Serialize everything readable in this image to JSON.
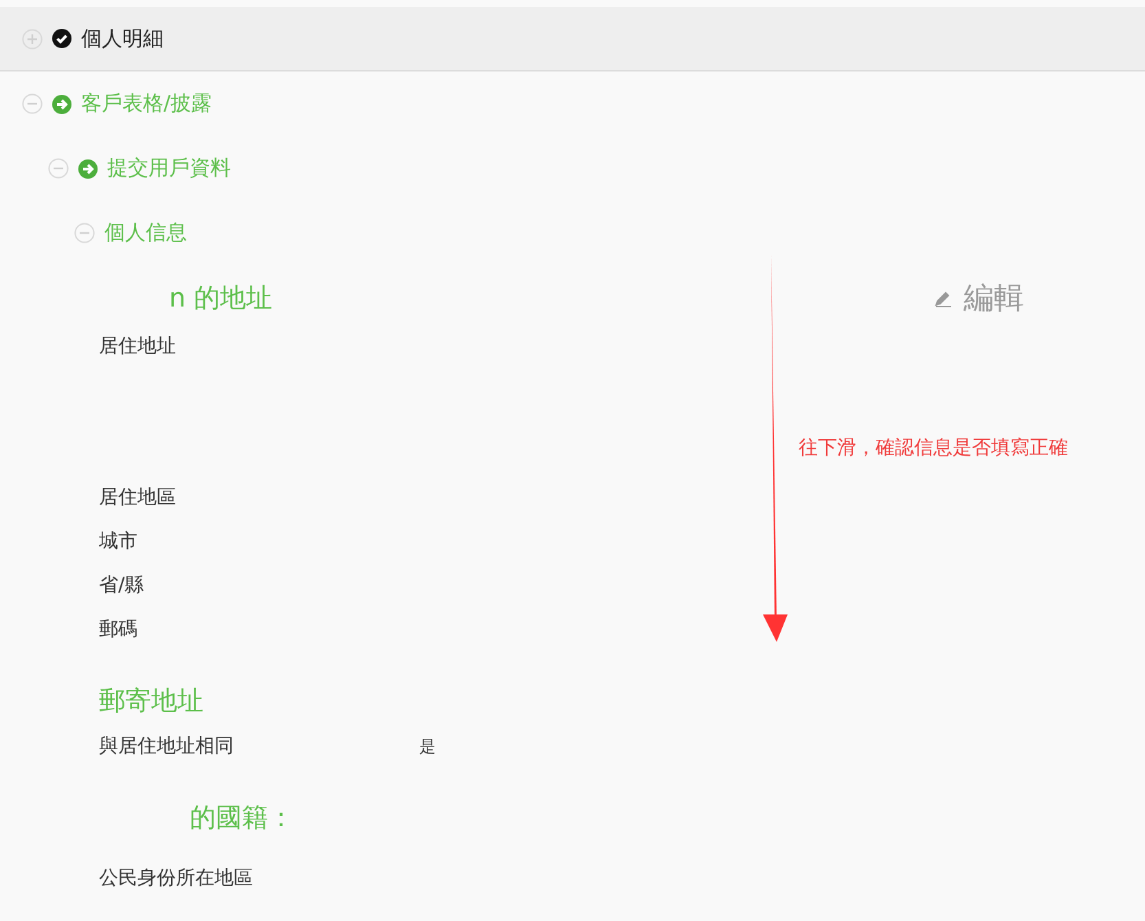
{
  "tree": [
    {
      "label": "個人明細",
      "expanded": false,
      "kind": "done"
    },
    {
      "label": "客戶表格/披露",
      "expanded": true,
      "kind": "current",
      "children": [
        {
          "label": "提交用戶資料",
          "expanded": true,
          "kind": "current",
          "children": [
            {
              "label": "個人信息",
              "expanded": true
            }
          ]
        }
      ]
    }
  ],
  "edit_link": {
    "label": "編輯"
  },
  "sections": [
    {
      "title": "n 的地址",
      "fields": [
        {
          "label": "居住地址"
        },
        {
          "label": "居住地區"
        },
        {
          "label": "城市"
        },
        {
          "label": "省/縣"
        },
        {
          "label": "郵碼"
        }
      ]
    },
    {
      "title": "郵寄地址",
      "fields": [
        {
          "label": "與居住地址相同",
          "value": "是"
        }
      ]
    },
    {
      "title": "的國籍：",
      "fields": [
        {
          "label": "公民身份所在地區"
        }
      ]
    }
  ],
  "annotation": {
    "text": "往下滑，確認信息是否填寫正確"
  }
}
